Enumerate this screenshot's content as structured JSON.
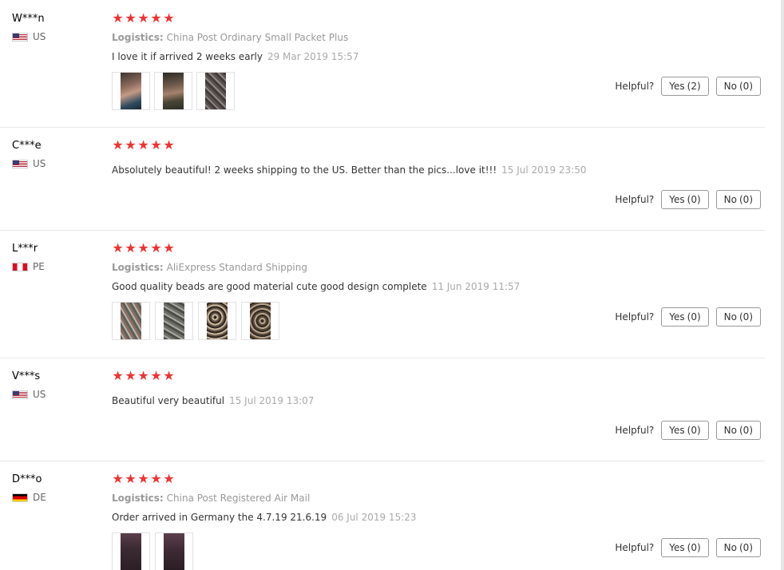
{
  "helpful_label": "Helpful?",
  "logistics_label": "Logistics:",
  "stars": [
    "★",
    "★",
    "★",
    "★",
    "★"
  ],
  "rating": 5,
  "colors": {
    "star": "#ee3333",
    "date": "#aaaaaa",
    "logistics": "#999999"
  },
  "reviews": [
    {
      "user": "W***n",
      "country": "US",
      "flag_icon": "us-flag-icon",
      "logistics": "China Post Ordinary Small Packet Plus",
      "text": "I love it if arrived 2 weeks early",
      "date": "29 Mar 2019 15:57",
      "yes_label": "Yes",
      "yes_count": "(2)",
      "no_label": "No",
      "no_count": "(0)",
      "photo_count": 3
    },
    {
      "user": "C***e",
      "country": "US",
      "flag_icon": "us-flag-icon",
      "logistics": "",
      "text": "Absolutely beautiful! 2 weeks shipping to the US. Better than the pics...love it!!!",
      "date": "15 Jul 2019 23:50",
      "yes_label": "Yes",
      "yes_count": "(0)",
      "no_label": "No",
      "no_count": "(0)",
      "photo_count": 0
    },
    {
      "user": "L***r",
      "country": "PE",
      "flag_icon": "pe-flag-icon",
      "logistics": "AliExpress Standard Shipping",
      "text": "Good quality beads are good material cute good design complete",
      "date": "11 Jun 2019 11:57",
      "yes_label": "Yes",
      "yes_count": "(0)",
      "no_label": "No",
      "no_count": "(0)",
      "photo_count": 4
    },
    {
      "user": "V***s",
      "country": "US",
      "flag_icon": "us-flag-icon",
      "logistics": "",
      "text": "Beautiful very beautiful",
      "date": "15 Jul 2019 13:07",
      "yes_label": "Yes",
      "yes_count": "(0)",
      "no_label": "No",
      "no_count": "(0)",
      "photo_count": 0
    },
    {
      "user": "D***o",
      "country": "DE",
      "flag_icon": "de-flag-icon",
      "logistics": "China Post Registered Air Mail",
      "text": "Order arrived in Germany the 4.7.19 21.6.19",
      "date": "06 Jul 2019 15:23",
      "yes_label": "Yes",
      "yes_count": "(0)",
      "no_label": "No",
      "no_count": "(0)",
      "photo_count": 2
    }
  ]
}
